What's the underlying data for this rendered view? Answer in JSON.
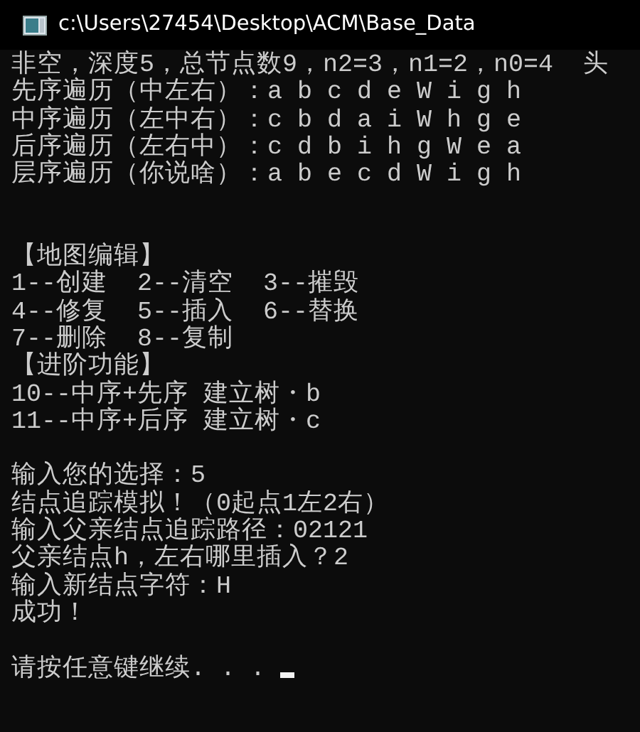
{
  "window": {
    "title": "c:\\Users\\27454\\Desktop\\ACM\\Base_Data"
  },
  "console": {
    "lines": [
      {
        "kind": "text",
        "text": "非空，深度5，总节点数9，n2=3，n1=2，n0=4  头"
      },
      {
        "kind": "text",
        "text": "先序遍历（中左右）：a b c d e W i g h"
      },
      {
        "kind": "text",
        "text": "中序遍历（左中右）：c b d a i W h g e"
      },
      {
        "kind": "text",
        "text": "后序遍历（左右中）：c d b i h g W e a"
      },
      {
        "kind": "text",
        "text": "层序遍历（你说啥）：a b e c d W i g h"
      },
      {
        "kind": "blank"
      },
      {
        "kind": "blank"
      },
      {
        "kind": "text",
        "text": "【地图编辑】"
      },
      {
        "kind": "text",
        "text": "1--创建  2--清空  3--摧毁"
      },
      {
        "kind": "text",
        "text": "4--修复  5--插入  6--替换"
      },
      {
        "kind": "text",
        "text": "7--删除  8--复制"
      },
      {
        "kind": "text",
        "text": "【进阶功能】"
      },
      {
        "kind": "text",
        "text": "10--中序+先序 建立树・b"
      },
      {
        "kind": "text",
        "text": "11--中序+后序 建立树・c"
      },
      {
        "kind": "blank"
      },
      {
        "kind": "text",
        "text": "输入您的选择：5"
      },
      {
        "kind": "text",
        "text": "结点追踪模拟！（0起点1左2右）"
      },
      {
        "kind": "text",
        "text": "输入父亲结点追踪路径：02121"
      },
      {
        "kind": "text",
        "text": "父亲结点h，左右哪里插入？2"
      },
      {
        "kind": "text",
        "text": "输入新结点字符：H"
      },
      {
        "kind": "text",
        "text": "成功！"
      },
      {
        "kind": "blank"
      },
      {
        "kind": "text",
        "text": "请按任意键继续. . . ",
        "cursor": true
      }
    ]
  }
}
